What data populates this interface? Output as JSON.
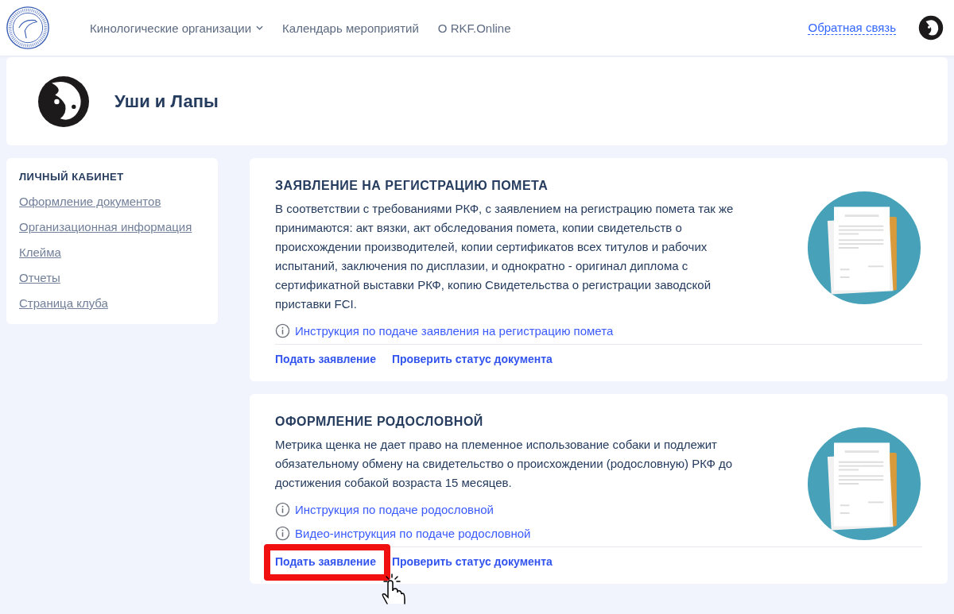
{
  "header": {
    "nav": [
      {
        "label": "Кинологические организации",
        "dropdown": true
      },
      {
        "label": "Календарь мероприятий",
        "dropdown": false
      },
      {
        "label": "О RKF.Online",
        "dropdown": false
      }
    ],
    "feedback": "Обратная связь"
  },
  "club": {
    "name": "Уши и Лапы"
  },
  "sidebar": {
    "title": "ЛИЧНЫЙ КАБИНЕТ",
    "items": [
      "Оформление документов",
      "Организационная информация",
      "Клейма",
      "Отчеты",
      "Страница клуба"
    ]
  },
  "cards": [
    {
      "title": "ЗАЯВЛЕНИЕ НА РЕГИСТРАЦИЮ ПОМЕТА",
      "description": "В соответствии с требованиями РКФ, с заявлением на регистрацию помета так же принимаются: акт вязки, акт обследования помета, копии свидетельств о происхождении производителей, копии сертификатов всех титулов и рабочих испытаний, заключения по дисплазии, и однократно - оригинал диплома с сертификатной выставки РКФ, копию Свидетельства о регистрации заводской приставки FCI.",
      "links": [
        "Инструкция по подаче заявления на регистрацию помета"
      ],
      "actions": [
        {
          "label": "Подать заявление",
          "highlighted": false
        },
        {
          "label": "Проверить статус документа",
          "highlighted": false
        }
      ]
    },
    {
      "title": "ОФОРМЛЕНИЕ РОДОСЛОВНОЙ",
      "description": "Метрика щенка не дает право на племенное использование собаки и подлежит обязательному обмену на свидетельство о происхождении (родословную) РКФ до достижения собакой возраста 15 месяцев.",
      "links": [
        "Инструкция по подаче родословной",
        "Видео-инструкция по подаче родословной"
      ],
      "actions": [
        {
          "label": "Подать заявление",
          "highlighted": true
        },
        {
          "label": "Проверить статус документа",
          "highlighted": false
        }
      ]
    }
  ]
}
